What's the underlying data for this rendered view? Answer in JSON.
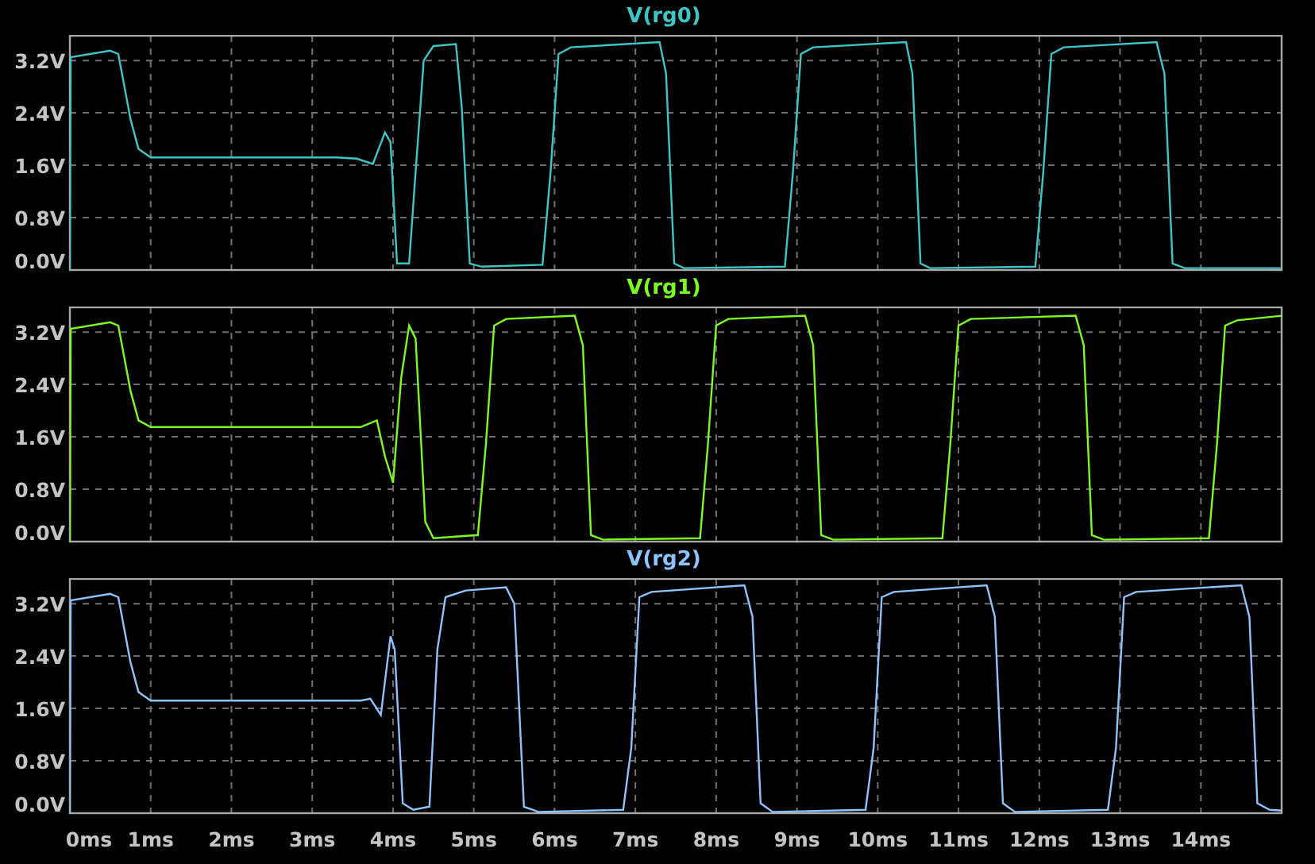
{
  "plots": [
    {
      "chart_data": {
        "type": "line",
        "grid": true,
        "xlim": [
          0,
          15
        ],
        "ylim": [
          0,
          3.59
        ],
        "yticks": [
          {
            "value": 0,
            "label": "0.0V"
          },
          {
            "value": 0.8,
            "label": "0.8V"
          },
          {
            "value": 1.6,
            "label": "1.6V"
          },
          {
            "value": 2.4,
            "label": "2.4V"
          },
          {
            "value": 3.2,
            "label": "3.2V"
          }
        ],
        "x": [
          0,
          0.01,
          0.5,
          0.6,
          0.75,
          0.85,
          1.0,
          3.3,
          3.55,
          3.75,
          3.9,
          3.97,
          4.05,
          4.2,
          4.28,
          4.38,
          4.5,
          4.78,
          4.85,
          4.95,
          5.1,
          5.85,
          5.95,
          6.05,
          6.2,
          7.3,
          7.38,
          7.48,
          7.6,
          8.85,
          8.95,
          9.05,
          9.2,
          10.35,
          10.43,
          10.53,
          10.65,
          11.95,
          12.05,
          12.15,
          12.3,
          13.45,
          13.55,
          13.65,
          13.8,
          15
        ],
        "series": [
          {
            "name": "V(rg0)",
            "color": "#3cc6c6",
            "values": [
              0,
              3.25,
              3.35,
              3.3,
              2.3,
              1.85,
              1.72,
              1.72,
              1.7,
              1.62,
              2.1,
              1.95,
              0.1,
              0.1,
              1.5,
              3.2,
              3.42,
              3.45,
              2.5,
              0.1,
              0.05,
              0.08,
              1.5,
              3.3,
              3.4,
              3.48,
              3.0,
              0.1,
              0.03,
              0.05,
              1.5,
              3.3,
              3.4,
              3.48,
              3.0,
              0.1,
              0.03,
              0.05,
              1.5,
              3.3,
              3.4,
              3.48,
              3.0,
              0.1,
              0.03,
              0.03
            ]
          }
        ]
      }
    },
    {
      "chart_data": {
        "type": "line",
        "grid": true,
        "xlim": [
          0,
          15
        ],
        "ylim": [
          0,
          3.59
        ],
        "yticks": [
          {
            "value": 0,
            "label": "0.0V"
          },
          {
            "value": 0.8,
            "label": "0.8V"
          },
          {
            "value": 1.6,
            "label": "1.6V"
          },
          {
            "value": 2.4,
            "label": "2.4V"
          },
          {
            "value": 3.2,
            "label": "3.2V"
          }
        ],
        "x": [
          0,
          0.01,
          0.5,
          0.6,
          0.75,
          0.85,
          1.0,
          3.6,
          3.8,
          3.9,
          4.0,
          4.1,
          4.2,
          4.28,
          4.4,
          4.5,
          5.05,
          5.15,
          5.25,
          5.4,
          6.25,
          6.35,
          6.45,
          6.6,
          7.8,
          7.9,
          8.0,
          8.15,
          9.1,
          9.2,
          9.3,
          9.45,
          10.8,
          10.9,
          11.0,
          11.15,
          12.45,
          12.55,
          12.65,
          12.8,
          14.1,
          14.2,
          14.3,
          14.45,
          15
        ],
        "series": [
          {
            "name": "V(rg1)",
            "color": "#7cfc1c",
            "values": [
              0,
              3.25,
              3.35,
              3.3,
              2.3,
              1.85,
              1.75,
              1.75,
              1.85,
              1.3,
              0.9,
              2.5,
              3.3,
              3.1,
              0.3,
              0.05,
              0.1,
              1.5,
              3.3,
              3.4,
              3.45,
              3.0,
              0.1,
              0.03,
              0.05,
              1.5,
              3.3,
              3.4,
              3.45,
              3.0,
              0.1,
              0.03,
              0.05,
              1.5,
              3.3,
              3.4,
              3.45,
              3.0,
              0.1,
              0.03,
              0.05,
              1.5,
              3.3,
              3.38,
              3.45
            ]
          }
        ]
      }
    },
    {
      "chart_data": {
        "type": "line",
        "grid": true,
        "xlim": [
          0,
          15
        ],
        "ylim": [
          0,
          3.59
        ],
        "xticks": [
          {
            "value": 0,
            "label": "0ms"
          },
          {
            "value": 1,
            "label": "1ms"
          },
          {
            "value": 2,
            "label": "2ms"
          },
          {
            "value": 3,
            "label": "3ms"
          },
          {
            "value": 4,
            "label": "4ms"
          },
          {
            "value": 5,
            "label": "5ms"
          },
          {
            "value": 6,
            "label": "6ms"
          },
          {
            "value": 7,
            "label": "7ms"
          },
          {
            "value": 8,
            "label": "8ms"
          },
          {
            "value": 9,
            "label": "9ms"
          },
          {
            "value": 10,
            "label": "10ms"
          },
          {
            "value": 11,
            "label": "11ms"
          },
          {
            "value": 12,
            "label": "12ms"
          },
          {
            "value": 13,
            "label": "13ms"
          },
          {
            "value": 14,
            "label": "14ms"
          }
        ],
        "yticks": [
          {
            "value": 0,
            "label": "0.0V"
          },
          {
            "value": 0.8,
            "label": "0.8V"
          },
          {
            "value": 1.6,
            "label": "1.6V"
          },
          {
            "value": 2.4,
            "label": "2.4V"
          },
          {
            "value": 3.2,
            "label": "3.2V"
          }
        ],
        "x": [
          0,
          0.01,
          0.5,
          0.6,
          0.75,
          0.85,
          1.0,
          3.6,
          3.72,
          3.85,
          3.97,
          4.02,
          4.12,
          4.25,
          4.45,
          4.55,
          4.65,
          4.9,
          5.4,
          5.5,
          5.62,
          5.8,
          6.85,
          6.95,
          7.05,
          7.2,
          8.35,
          8.45,
          8.55,
          8.7,
          9.85,
          9.95,
          10.05,
          10.2,
          11.35,
          11.45,
          11.55,
          11.7,
          12.85,
          12.95,
          13.05,
          13.2,
          14.5,
          14.6,
          14.7,
          14.85,
          15
        ],
        "series": [
          {
            "name": "V(rg2)",
            "color": "#8cc4ff",
            "values": [
              0,
              3.25,
              3.35,
              3.3,
              2.3,
              1.85,
              1.72,
              1.72,
              1.75,
              1.5,
              2.7,
              2.5,
              0.15,
              0.05,
              0.1,
              2.5,
              3.3,
              3.4,
              3.45,
              3.2,
              0.1,
              0.02,
              0.05,
              1.0,
              3.3,
              3.38,
              3.48,
              3.0,
              0.15,
              0.02,
              0.05,
              1.0,
              3.3,
              3.38,
              3.48,
              3.0,
              0.15,
              0.02,
              0.05,
              1.0,
              3.3,
              3.38,
              3.48,
              3.0,
              0.15,
              0.05,
              0.04
            ]
          }
        ]
      }
    }
  ]
}
